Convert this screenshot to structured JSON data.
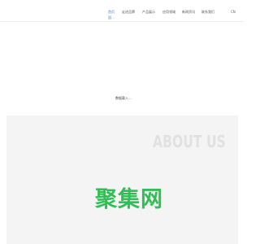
{
  "nav": {
    "items": [
      {
        "label": "首页"
      },
      {
        "label": "走进品牌"
      },
      {
        "label": "产品展示"
      },
      {
        "label": "应用领域"
      },
      {
        "label": "新闻资讯"
      },
      {
        "label": "联系我们"
      }
    ],
    "active_sub": "国...",
    "lang": "CN"
  },
  "status": {
    "loading": "数据载入..."
  },
  "about": {
    "title": "ABOUT US"
  },
  "watermark": {
    "text": "聚集网"
  },
  "colors": {
    "accent": "#4a7fd6",
    "watermark": "#2fbf54"
  }
}
